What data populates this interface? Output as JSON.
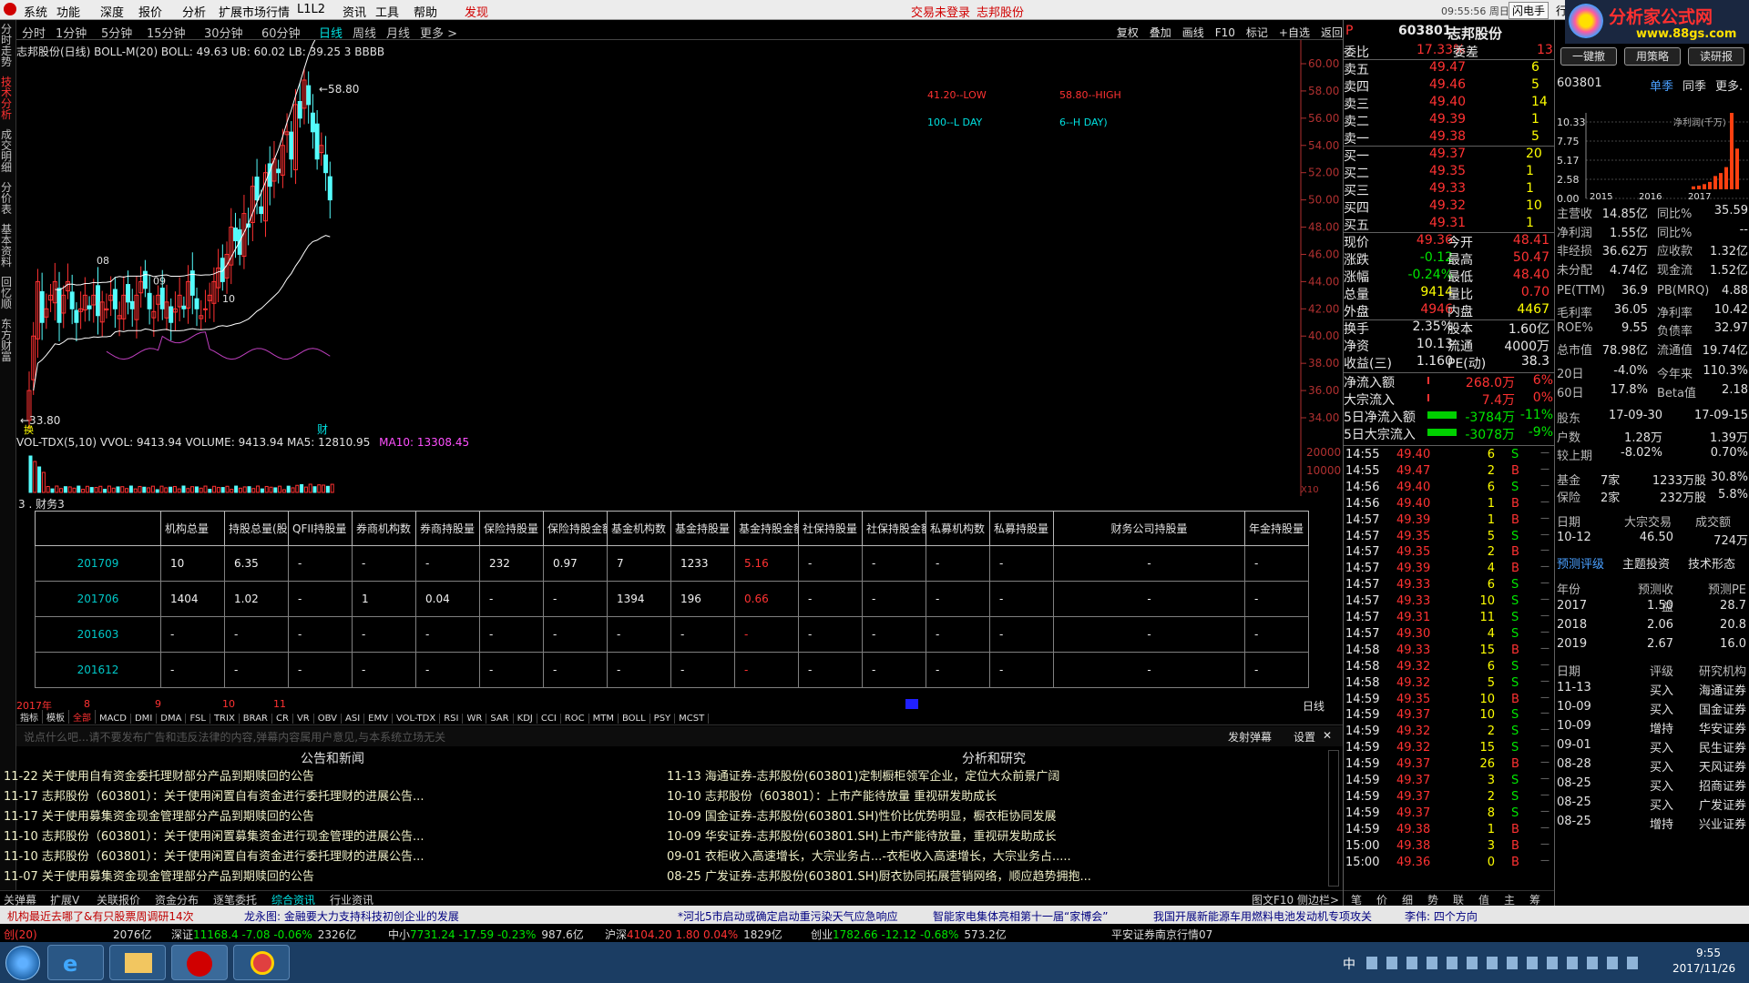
{
  "menu": {
    "logo_colors": [
      "#e00000"
    ],
    "items": [
      "系统",
      "功能",
      "深度",
      "报价",
      "分析",
      "扩展市场行情",
      "L1L2",
      "资讯",
      "工具",
      "帮助"
    ],
    "discover": "发现",
    "login": "交易未登录",
    "stock": "志邦股份",
    "clock": "09:55:56 周日",
    "flash": "闪电手",
    "row": "行"
  },
  "logo": {
    "text": "分析家公式网",
    "url": "www.88gs.com"
  },
  "left_tabs": [
    "分时走势",
    "技术分析",
    "成交明细",
    "分价表",
    "基本资料",
    "回忆顺",
    "东方财富"
  ],
  "periods": [
    "分时",
    "1分钟",
    "5分钟",
    "15分钟",
    "30分钟",
    "60分钟",
    "日线",
    "周线",
    "月线",
    "更多 >"
  ],
  "active_period": "日线",
  "toolbar": [
    "复权",
    "叠加",
    "画线",
    "F10",
    "标记",
    "+自选",
    "返回"
  ],
  "kchart": {
    "title": "志邦股份(日线) BOLL-M(20)  BOLL: 49.63  UB: 60.02  LB: 39.25  3  BBBB",
    "ylabels": [
      "60.00",
      "58.00",
      "56.00",
      "54.00",
      "52.00",
      "50.00",
      "48.00",
      "46.00",
      "44.00",
      "42.00",
      "40.00",
      "38.00",
      "36.00",
      "34.00"
    ],
    "ymin": 34,
    "ymax": 60,
    "high_label": "58.80",
    "low_label": "33.80",
    "marks": [
      "08",
      "09",
      "10"
    ],
    "legend": [
      "41.20--LOW",
      "58.80--HIGH",
      "100--L DAY",
      "6--H DAY)"
    ],
    "cai": "财",
    "bottom_mark": "换"
  },
  "vol": {
    "title": "VOL-TDX(5,10)  VVOL: 9413.94  VOLUME: 9413.94  MA5: 12810.95",
    "ma10": "MA10: 13308.45",
    "ylabels": [
      "20000",
      "10000"
    ],
    "unit": "X10"
  },
  "fin": {
    "title": "3 . 财务3",
    "headers": [
      "机构总量",
      "持股总量(股",
      "QFII持股量",
      "券商机构数",
      "券商持股量",
      "保险持股量",
      "保险持股金额",
      "基金机构数",
      "基金持股量",
      "基金持股金额",
      "社保持股量",
      "社保持股金额",
      "私募机构数",
      "私募持股量",
      "财务公司持股量",
      "年金持股量"
    ],
    "rows": [
      {
        "date": "201709",
        "cells": [
          "10",
          "6.35",
          "-",
          "-",
          "-",
          "232",
          "0.97",
          "7",
          "1233",
          "5.16",
          "-",
          "-",
          "-",
          "-",
          "-",
          "-"
        ]
      },
      {
        "date": "201706",
        "cells": [
          "1404",
          "1.02",
          "-",
          "1",
          "0.04",
          "-",
          "-",
          "1394",
          "196",
          "0.66",
          "-",
          "-",
          "-",
          "-",
          "-",
          "-"
        ]
      },
      {
        "date": "201603",
        "cells": [
          "-",
          "-",
          "-",
          "-",
          "-",
          "-",
          "-",
          "-",
          "-",
          "-",
          "-",
          "-",
          "-",
          "-",
          "-",
          "-"
        ]
      },
      {
        "date": "201612",
        "cells": [
          "-",
          "-",
          "-",
          "-",
          "-",
          "-",
          "-",
          "-",
          "-",
          "-",
          "-",
          "-",
          "-",
          "-",
          "-",
          "-"
        ]
      }
    ],
    "xaxis": [
      "2017年",
      "8",
      "9",
      "10",
      "11"
    ],
    "period_label": "日线",
    "red_index": 9
  },
  "ind_tabs": [
    "指标",
    "模板",
    "全部",
    "MACD",
    "DMI",
    "DMA",
    "FSL",
    "TRIX",
    "BRAR",
    "CR",
    "VR",
    "OBV",
    "ASI",
    "EMV",
    "VOL-TDX",
    "RSI",
    "WR",
    "SAR",
    "KDJ",
    "CCI",
    "ROC",
    "MTM",
    "BOLL",
    "PSY",
    "MCST"
  ],
  "comment": {
    "placeholder": "说点什么吧...请不要发布广告和违反法律的内容,弹幕内容属用户意见,与本系统立场无关",
    "send": "发射弹幕",
    "settings": "设置",
    "close": "✕"
  },
  "news": {
    "left_title": "公告和新闻",
    "right_title": "分析和研究",
    "left": [
      {
        "date": "11-22",
        "text": "关于使用自有资金委托理财部分产品到期赎回的公告"
      },
      {
        "date": "11-17",
        "text": "志邦股份（603801）：关于使用闲置自有资金进行委托理财的进展公告..."
      },
      {
        "date": "11-17",
        "text": "关于使用募集资金现金管理部分产品到期赎回的公告"
      },
      {
        "date": "11-10",
        "text": "志邦股份（603801）：关于使用闲置募集资金进行现金管理的进展公告..."
      },
      {
        "date": "11-10",
        "text": "志邦股份（603801）：关于使用闲置自有资金进行委托理财的进展公告..."
      },
      {
        "date": "11-07",
        "text": "关于使用募集资金现金管理部分产品到期赎回的公告"
      }
    ],
    "right": [
      {
        "date": "11-13",
        "text": "海通证券-志邦股份(603801)定制橱柜领军企业，定位大众前景广阔"
      },
      {
        "date": "10-10",
        "text": "志邦股份（603801）：上市产能待放量 重视研发助成长"
      },
      {
        "date": "10-09",
        "text": "国金证券-志邦股份(603801.SH)性价比优势明显，橱衣柜协同发展"
      },
      {
        "date": "10-09",
        "text": "华安证券-志邦股份(603801.SH)上市产能待放量，重视研发助成长"
      },
      {
        "date": "09-01",
        "text": "衣柜收入高速增长，大宗业务占...-衣柜收入高速增长，大宗业务占....."
      },
      {
        "date": "08-25",
        "text": "广发证券-志邦股份(603801.SH)厨衣协同拓展营销网络，顺应趋势拥抱..."
      }
    ]
  },
  "news_tabs": [
    "关弹幕",
    "扩展V",
    "关联报价",
    "资金分布",
    "逐笔委托",
    "综合资讯",
    "行业资讯"
  ],
  "news_tabs_right": [
    "图文F10",
    "侧边栏>"
  ],
  "quote": {
    "code": "603801",
    "name": "志邦股份",
    "prefix": "P",
    "weibi_label": "委比",
    "weibi": "17.33%",
    "weicha_label": "委差",
    "weicha": "13",
    "sell": [
      [
        "卖五",
        "49.47",
        "6"
      ],
      [
        "卖四",
        "49.46",
        "5"
      ],
      [
        "卖三",
        "49.40",
        "14"
      ],
      [
        "卖二",
        "49.39",
        "1"
      ],
      [
        "卖一",
        "49.38",
        "5"
      ]
    ],
    "buy": [
      [
        "买一",
        "49.37",
        "20"
      ],
      [
        "买二",
        "49.35",
        "1"
      ],
      [
        "买三",
        "49.33",
        "1"
      ],
      [
        "买四",
        "49.32",
        "10"
      ],
      [
        "买五",
        "49.31",
        "1"
      ]
    ],
    "stats": [
      [
        "现价",
        "49.36",
        "今开",
        "48.41"
      ],
      [
        "涨跌",
        "-0.12",
        "最高",
        "50.47"
      ],
      [
        "涨幅",
        "-0.24%",
        "最低",
        "48.40"
      ],
      [
        "总量",
        "9414",
        "量比",
        "0.70"
      ],
      [
        "外盘",
        "4946",
        "内盘",
        "4467"
      ],
      [
        "换手",
        "2.35%",
        "股本",
        "1.60亿"
      ],
      [
        "净资",
        "10.13",
        "流通",
        "4000万"
      ],
      [
        "收益(三)",
        "1.160",
        "PE(动)",
        "38.3"
      ]
    ],
    "flows": [
      [
        "净流入额",
        "268.0万",
        "6%"
      ],
      [
        "大宗流入",
        "7.4万",
        "0%"
      ],
      [
        "5日净流入额",
        "-3784万",
        "-11%"
      ],
      [
        "5日大宗流入",
        "-3078万",
        "-9%"
      ]
    ],
    "ticks": [
      [
        "14:55",
        "49.40",
        "6",
        "S"
      ],
      [
        "14:55",
        "49.47",
        "2",
        "B"
      ],
      [
        "14:56",
        "49.40",
        "6",
        "S"
      ],
      [
        "14:56",
        "49.40",
        "1",
        "B"
      ],
      [
        "14:57",
        "49.39",
        "1",
        "B"
      ],
      [
        "14:57",
        "49.35",
        "5",
        "S"
      ],
      [
        "14:57",
        "49.35",
        "2",
        "B"
      ],
      [
        "14:57",
        "49.39",
        "4",
        "B"
      ],
      [
        "14:57",
        "49.33",
        "6",
        "S"
      ],
      [
        "14:57",
        "49.33",
        "10",
        "S"
      ],
      [
        "14:57",
        "49.31",
        "11",
        "S"
      ],
      [
        "14:57",
        "49.30",
        "4",
        "S"
      ],
      [
        "14:58",
        "49.33",
        "15",
        "B"
      ],
      [
        "14:58",
        "49.32",
        "6",
        "S"
      ],
      [
        "14:58",
        "49.32",
        "5",
        "S"
      ],
      [
        "14:59",
        "49.35",
        "10",
        "B"
      ],
      [
        "14:59",
        "49.37",
        "10",
        "S"
      ],
      [
        "14:59",
        "49.32",
        "2",
        "S"
      ],
      [
        "14:59",
        "49.32",
        "15",
        "S"
      ],
      [
        "14:59",
        "49.37",
        "26",
        "B"
      ],
      [
        "14:59",
        "49.37",
        "3",
        "S"
      ],
      [
        "14:59",
        "49.37",
        "2",
        "S"
      ],
      [
        "14:59",
        "49.37",
        "8",
        "S"
      ],
      [
        "14:59",
        "49.38",
        "1",
        "B"
      ],
      [
        "15:00",
        "49.38",
        "3",
        "B"
      ],
      [
        "15:00",
        "49.36",
        "0",
        "B"
      ]
    ],
    "right_tabs": [
      "笔",
      "价",
      "细",
      "势",
      "联",
      "值",
      "主",
      "筹"
    ]
  },
  "far": {
    "buttons": [
      "一键撤",
      "用策略",
      "读研报"
    ],
    "code": "603801",
    "tabs": [
      "单季",
      "同季",
      "更多."
    ],
    "chart": {
      "ylabel": "净利润(千万)",
      "yticks": [
        "10.33",
        "7.75",
        "5.17",
        "2.58",
        "0.00"
      ],
      "years": [
        "2015",
        "2016",
        "2017"
      ],
      "values": [
        0.4,
        0.5,
        0.7,
        1.0,
        1.8,
        2.2,
        3.0,
        10.33,
        5.5
      ]
    },
    "fund": [
      [
        "主营收",
        "14.85亿",
        "同比%",
        "35.59"
      ],
      [
        "净利润",
        "1.55亿",
        "同比%",
        "--"
      ],
      [
        "非经损",
        "36.62万",
        "应收款",
        "1.32亿"
      ],
      [
        "未分配",
        "4.74亿",
        "现金流",
        "1.52亿"
      ],
      [
        "PE(TTM)",
        "36.9",
        "PB(MRQ)",
        "4.88"
      ],
      [
        "毛利率",
        "36.05",
        "净利率",
        "10.42"
      ],
      [
        "ROE%",
        "9.55",
        "负债率",
        "32.97"
      ],
      [
        "总市值",
        "78.98亿",
        "流通值",
        "19.74亿"
      ],
      [
        "20日",
        "-4.0%",
        "今年来",
        "110.3%"
      ],
      [
        "60日",
        "17.8%",
        "Beta值",
        "2.18"
      ]
    ],
    "holders": [
      [
        "股东",
        "17-09-30",
        "17-09-15"
      ],
      [
        "户数",
        "1.28万",
        "1.39万"
      ],
      [
        "较上期",
        "-8.02%",
        "0.70%"
      ]
    ],
    "inst": [
      [
        "基金",
        "7家",
        "1233万股",
        "30.8%"
      ],
      [
        "保险",
        "2家",
        "232万股",
        "5.8%"
      ]
    ],
    "deal_head": [
      "日期",
      "大宗交易",
      "成交额"
    ],
    "deal": [
      "10-12",
      "46.50",
      "724万"
    ],
    "rating_tabs": [
      "预测评级",
      "主题投资",
      "技术形态"
    ],
    "forecast_head": [
      "年份",
      "预测收益",
      "预测PE"
    ],
    "forecast": [
      [
        "2017",
        "1.50",
        "28.7"
      ],
      [
        "2018",
        "2.06",
        "20.8"
      ],
      [
        "2019",
        "2.67",
        "16.0"
      ]
    ],
    "rating_head": [
      "日期",
      "评级",
      "研究机构"
    ],
    "ratings": [
      [
        "11-13",
        "买入",
        "海通证券"
      ],
      [
        "10-09",
        "买入",
        "国金证券"
      ],
      [
        "10-09",
        "增持",
        "华安证券"
      ],
      [
        "09-01",
        "买入",
        "民生证券"
      ],
      [
        "08-28",
        "买入",
        "天风证券"
      ],
      [
        "08-25",
        "买入",
        "招商证券"
      ],
      [
        "08-25",
        "买入",
        "广发证券"
      ],
      [
        "08-25",
        "增持",
        "兴业证券"
      ]
    ]
  },
  "ticker": {
    "items": [
      "机构最近去哪了&有只股票周调研14次",
      "龙永图: 金融要大力支持科技初创企业的发展",
      "*河北5市启动或确定启动重污染天气应急响应",
      "智能家电集体亮相第十一届“家博会”",
      "我国开展新能源车用燃料电池发动机专项攻关",
      "李伟: 四个方向"
    ]
  },
  "status": {
    "cyb": "创(20)",
    "items": [
      [
        "2076亿",
        ""
      ],
      [
        "深证",
        "11168.4",
        "-7.08",
        "-0.06%",
        "2326亿"
      ],
      [
        "中小",
        "7731.24",
        "-17.59",
        "-0.23%",
        "987.6亿"
      ],
      [
        "沪深",
        "4104.20",
        "1.80",
        "0.04%",
        "1829亿"
      ],
      [
        "创业",
        "1782.66",
        "-12.12",
        "-0.68%",
        "573.2亿"
      ]
    ],
    "broker": "平安证券南京行情07"
  },
  "taskbar": {
    "time": "9:55",
    "date": "2017/11/26",
    "ime": "中"
  }
}
